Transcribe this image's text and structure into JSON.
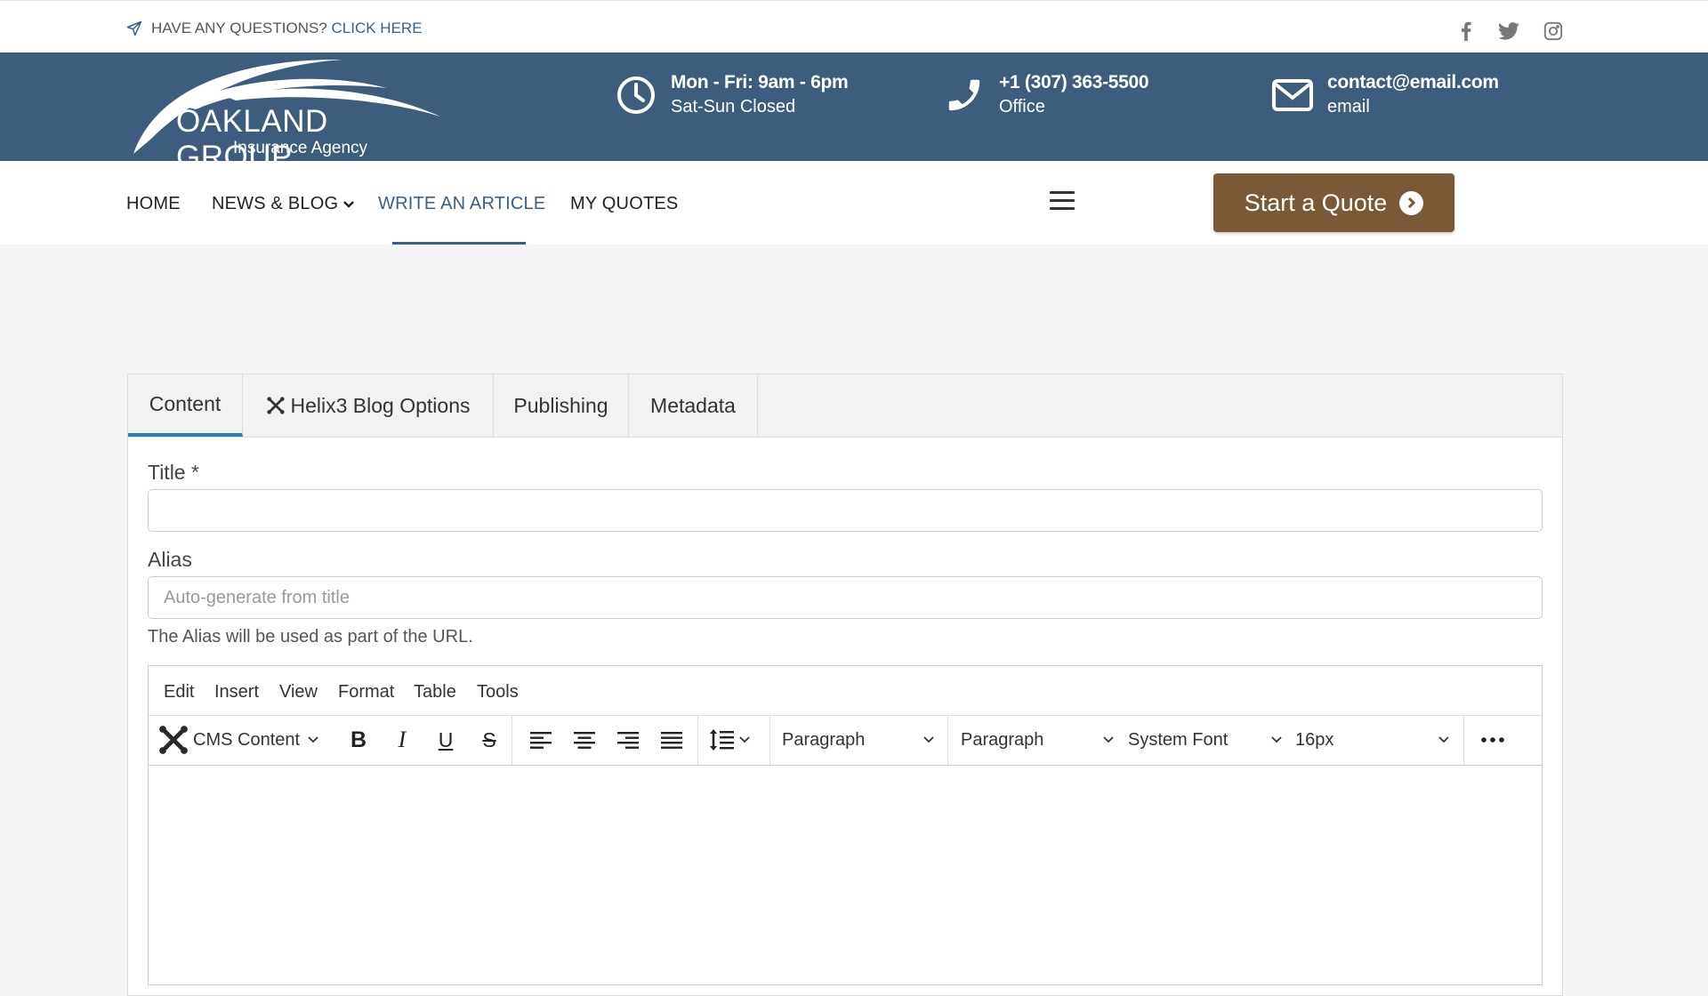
{
  "topbar": {
    "question_text": "HAVE ANY QUESTIONS?",
    "question_link": "CLICK HERE",
    "social": [
      "facebook-icon",
      "twitter-icon",
      "instagram-icon"
    ]
  },
  "header": {
    "logo_name": "OAKLAND GROUP",
    "logo_sub": "Insurance Agency",
    "hours_line1": "Mon - Fri: 9am - 6pm",
    "hours_line2": "Sat-Sun Closed",
    "phone_line1": "+1 (307) 363-5500",
    "phone_line2": "Office",
    "email_line1": "contact@email.com",
    "email_line2": "email"
  },
  "nav": {
    "items": [
      "HOME",
      "NEWS & BLOG",
      "WRITE AN ARTICLE",
      "MY QUOTES"
    ],
    "active": "WRITE AN ARTICLE",
    "cta": "Start a Quote"
  },
  "form": {
    "tabs": [
      "Content",
      "Helix3 Blog Options",
      "Publishing",
      "Metadata"
    ],
    "active_tab": "Content",
    "title_label": "Title *",
    "title_value": "",
    "alias_label": "Alias",
    "alias_placeholder": "Auto-generate from title",
    "alias_hint": "The Alias will be used as part of the URL."
  },
  "editor": {
    "menu": [
      "Edit",
      "Insert",
      "View",
      "Format",
      "Table",
      "Tools"
    ],
    "cms_content": "CMS Content",
    "block_format_1": "Paragraph",
    "block_format_2": "Paragraph",
    "font_family": "System Font",
    "font_size": "16px"
  },
  "colors": {
    "header_band": "#3e5c7e",
    "cta": "#7a5a36",
    "accent": "#2b7bb9",
    "link": "#3b5f86"
  }
}
